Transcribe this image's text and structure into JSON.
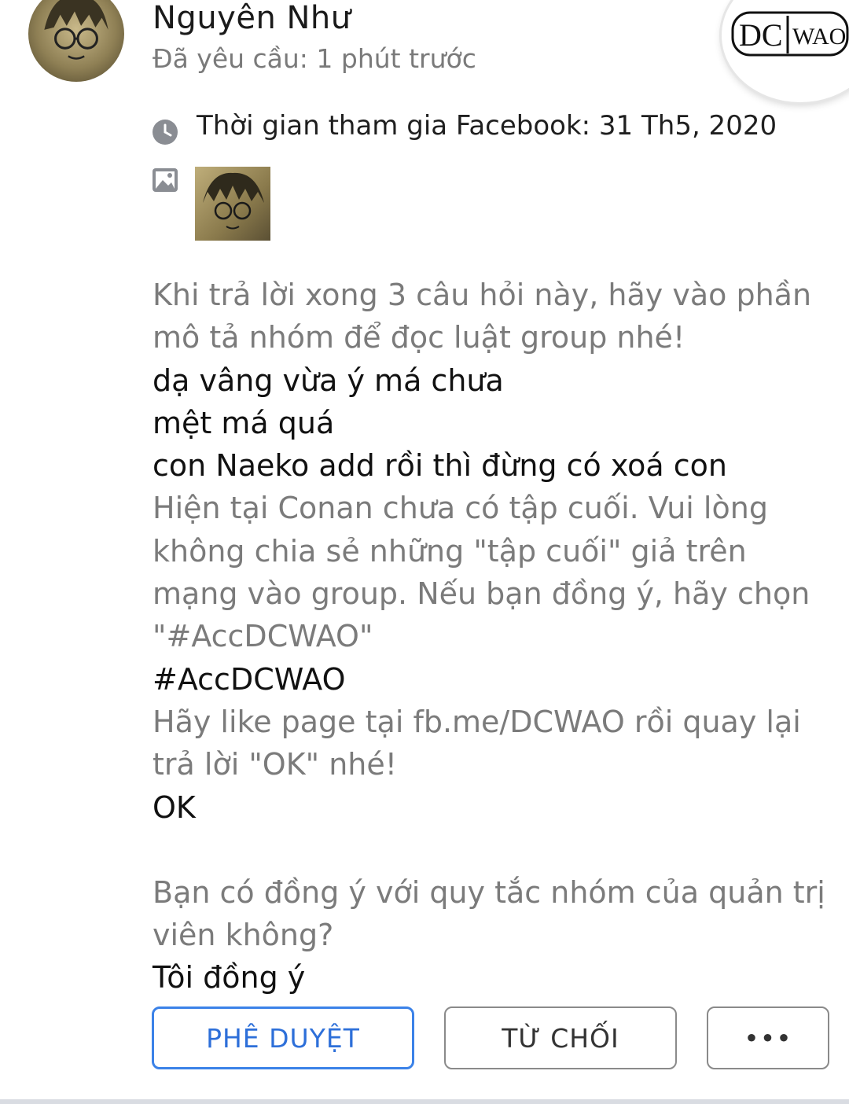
{
  "request": {
    "name": "Nguyên Như",
    "requested": "Đã yêu cầu: 1 phút trước",
    "joined": "Thời gian tham gia Facebook: 31 Th5, 2020"
  },
  "logo": {
    "part1": "DC",
    "part2": "WAO"
  },
  "qa": [
    {
      "question": "Khi trả lời xong 3 câu hỏi này, hãy vào phần mô tả nhóm để đọc luật group nhé!",
      "answer": "dạ vâng vừa ý má chưa\nmệt má quá\ncon Naeko add rồi thì đừng có xoá con"
    },
    {
      "question": "Hiện tại Conan chưa có tập cuối. Vui lòng không chia sẻ những \"tập cuối\" giả trên mạng vào group. Nếu bạn đồng ý, hãy chọn \"#AccDCWAO\"",
      "answer": "#AccDCWAO"
    },
    {
      "question": "Hãy like page tại fb.me/DCWAO rồi quay lại trả lời \"OK\" nhé!",
      "answer": "OK"
    },
    {
      "question": "Bạn có đồng ý với quy tắc nhóm của quản trị viên không?",
      "answer": "Tôi đồng ý"
    }
  ],
  "actions": {
    "approve": "PHÊ DUYỆT",
    "decline": "TỪ CHỐI",
    "more": "•••"
  },
  "colors": {
    "accent": "#2d6fd9",
    "question_text": "#7b7b7b",
    "answer_text": "#111111"
  }
}
